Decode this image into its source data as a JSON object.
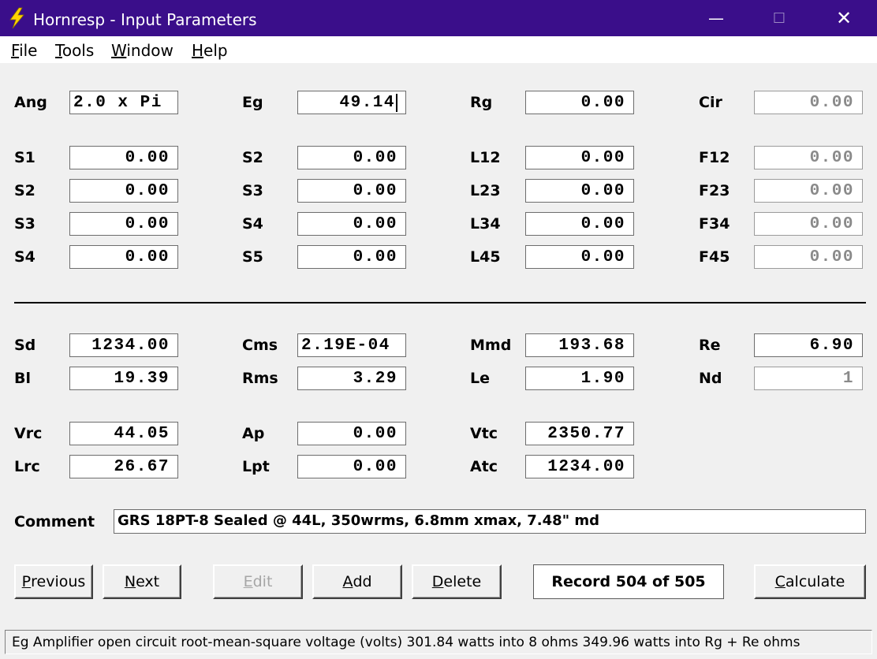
{
  "window": {
    "title": "Hornresp - Input Parameters",
    "min_glyph": "—",
    "max_glyph": "☐",
    "close_glyph": "✕"
  },
  "menu": [
    {
      "key": "F",
      "rest": "ile"
    },
    {
      "key": "T",
      "rest": "ools"
    },
    {
      "key": "W",
      "rest": "indow"
    },
    {
      "key": "H",
      "rest": "elp"
    }
  ],
  "params": {
    "ang": {
      "label": "Ang",
      "value": "2.0 x Pi"
    },
    "eg": {
      "label": "Eg",
      "value": "49.14"
    },
    "rg": {
      "label": "Rg",
      "value": "0.00"
    },
    "cir": {
      "label": "Cir",
      "value": "0.00"
    },
    "col1": [
      {
        "label": "S1",
        "value": "0.00"
      },
      {
        "label": "S2",
        "value": "0.00"
      },
      {
        "label": "S3",
        "value": "0.00"
      },
      {
        "label": "S4",
        "value": "0.00"
      }
    ],
    "col2": [
      {
        "label": "S2",
        "value": "0.00"
      },
      {
        "label": "S3",
        "value": "0.00"
      },
      {
        "label": "S4",
        "value": "0.00"
      },
      {
        "label": "S5",
        "value": "0.00"
      }
    ],
    "col3": [
      {
        "label": "L12",
        "value": "0.00"
      },
      {
        "label": "L23",
        "value": "0.00"
      },
      {
        "label": "L34",
        "value": "0.00"
      },
      {
        "label": "L45",
        "value": "0.00"
      }
    ],
    "col4": [
      {
        "label": "F12",
        "value": "0.00"
      },
      {
        "label": "F23",
        "value": "0.00"
      },
      {
        "label": "F34",
        "value": "0.00"
      },
      {
        "label": "F45",
        "value": "0.00"
      }
    ],
    "driver": {
      "sd": {
        "label": "Sd",
        "value": "1234.00"
      },
      "cms": {
        "label": "Cms",
        "value": "2.19E-04"
      },
      "mmd": {
        "label": "Mmd",
        "value": "193.68"
      },
      "re": {
        "label": "Re",
        "value": "6.90"
      },
      "bl": {
        "label": "Bl",
        "value": "19.39"
      },
      "rms": {
        "label": "Rms",
        "value": "3.29"
      },
      "le": {
        "label": "Le",
        "value": "1.90"
      },
      "nd": {
        "label": "Nd",
        "value": "1"
      }
    },
    "chamber": {
      "vrc": {
        "label": "Vrc",
        "value": "44.05"
      },
      "ap": {
        "label": "Ap",
        "value": "0.00"
      },
      "vtc": {
        "label": "Vtc",
        "value": "2350.77"
      },
      "lrc": {
        "label": "Lrc",
        "value": "26.67"
      },
      "lpt": {
        "label": "Lpt",
        "value": "0.00"
      },
      "atc": {
        "label": "Atc",
        "value": "1234.00"
      }
    }
  },
  "comment": {
    "label": "Comment",
    "value": "GRS 18PT-8 Sealed @ 44L, 350wrms, 6.8mm xmax, 7.48\" md"
  },
  "buttons": {
    "previous": {
      "key": "P",
      "rest": "revious"
    },
    "next": {
      "key": "N",
      "rest": "ext"
    },
    "edit": {
      "key": "E",
      "rest": "dit"
    },
    "add": {
      "key": "A",
      "rest": "dd"
    },
    "delete": {
      "key": "D",
      "rest": "elete"
    },
    "calculate": {
      "key": "C",
      "rest": "alculate"
    }
  },
  "record": "Record 504 of 505",
  "status": "Eg  Amplifier open circuit root-mean-square voltage  (volts)  301.84 watts into 8 ohms   349.96 watts into Rg + Re ohms"
}
